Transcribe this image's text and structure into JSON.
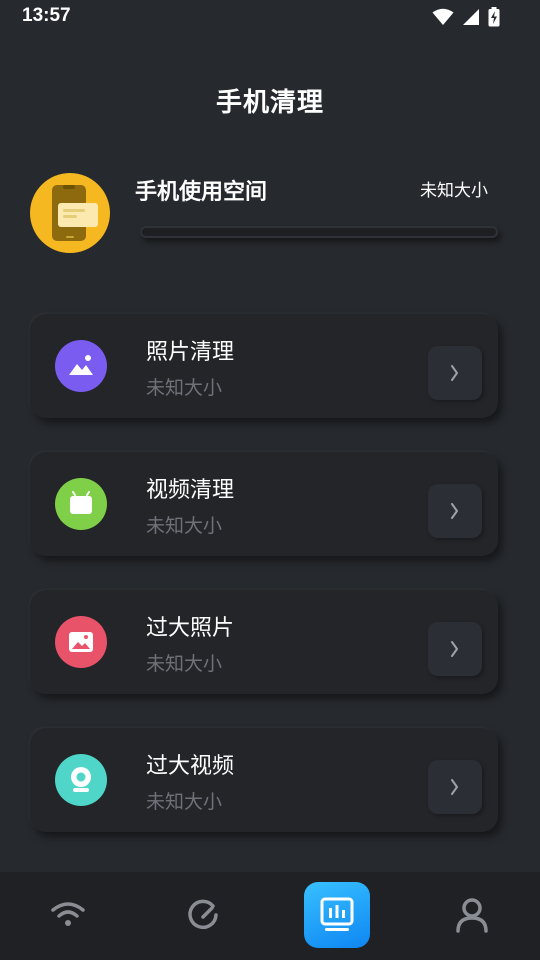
{
  "status_bar": {
    "time": "13:57",
    "icons": [
      "wifi-icon",
      "cellular-signal-icon",
      "battery-charging-icon"
    ]
  },
  "header": {
    "title": "手机清理"
  },
  "storage": {
    "title": "手机使用空间",
    "size": "未知大小",
    "usage_fraction": 0,
    "icon": "phone-icon",
    "icon_color": "#f5b820"
  },
  "cards": [
    {
      "title": "照片清理",
      "subtitle": "未知大小",
      "icon": "photo-icon",
      "color": "#7b5cf0"
    },
    {
      "title": "视频清理",
      "subtitle": "未知大小",
      "icon": "tv-icon",
      "color": "#7fcf48"
    },
    {
      "title": "过大照片",
      "subtitle": "未知大小",
      "icon": "image-icon",
      "color": "#e8536a"
    },
    {
      "title": "过大视频",
      "subtitle": "未知大小",
      "icon": "webcam-icon",
      "color": "#4fd6c9"
    }
  ],
  "bottom_nav": {
    "items": [
      {
        "icon": "wifi-icon",
        "active": false
      },
      {
        "icon": "speedometer-icon",
        "active": false
      },
      {
        "icon": "cleaner-icon",
        "active": true
      },
      {
        "icon": "user-icon",
        "active": false
      }
    ],
    "accent": "#1a9dff"
  }
}
